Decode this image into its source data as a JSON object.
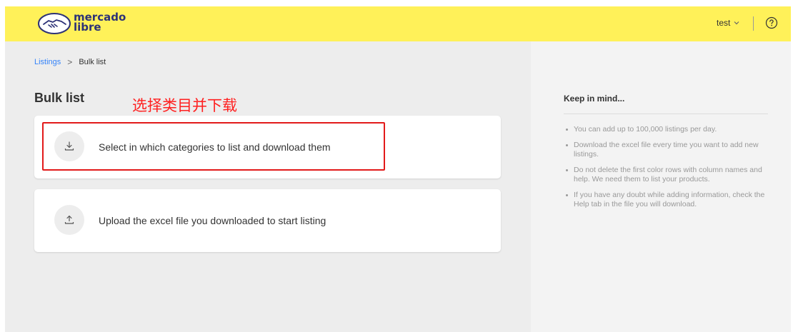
{
  "header": {
    "logo_line1": "mercado",
    "logo_line2": "libre",
    "user_name": "test",
    "brand_yellow": "#fff159",
    "brand_blue": "#2d3277"
  },
  "breadcrumb": {
    "parent": "Listings",
    "separator": ">",
    "current": "Bulk list"
  },
  "page": {
    "title": "Bulk list",
    "annotation": "选择类目并下载"
  },
  "cards": [
    {
      "label": "Select in which categories to list and download them",
      "icon": "download-icon"
    },
    {
      "label": "Upload the excel file you downloaded to start listing",
      "icon": "upload-icon"
    }
  ],
  "aside": {
    "title": "Keep in mind...",
    "tips": [
      "You can add up to 100,000 listings per day.",
      "Download the excel file every time you want to add new listings.",
      "Do not delete the first color rows with column names and help. We need them to list your products.",
      "If you have any doubt while adding information, check the Help tab in the file you will download."
    ]
  },
  "colors": {
    "link": "#3483fa",
    "annotation_red": "#ff1f1f"
  }
}
